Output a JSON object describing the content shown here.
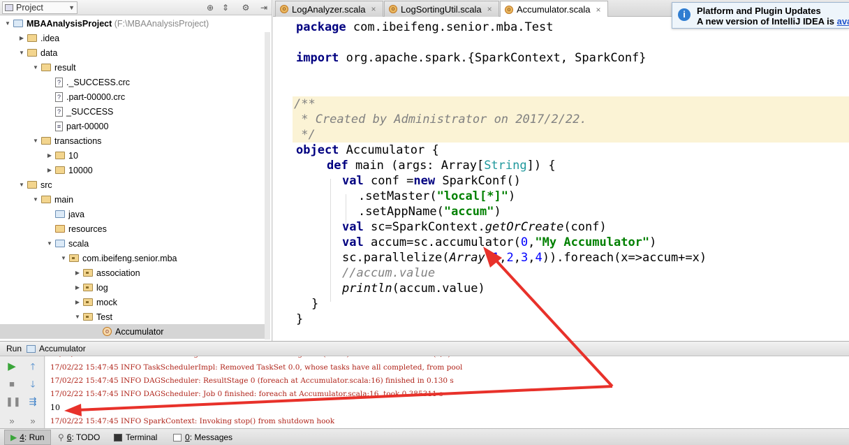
{
  "project_panel": {
    "selector_label": "Project",
    "tree": [
      {
        "label": "MBAAnalysisProject",
        "hint": "(F:\\MBAAnalysisProject)",
        "kind": "module",
        "expanded": true
      },
      {
        "label": ".idea",
        "kind": "folder",
        "expanded": false
      },
      {
        "label": "data",
        "kind": "folder",
        "expanded": true
      },
      {
        "label": "result",
        "kind": "folder",
        "expanded": true
      },
      {
        "label": "._SUCCESS.crc",
        "kind": "file"
      },
      {
        "label": ".part-00000.crc",
        "kind": "file"
      },
      {
        "label": "_SUCCESS",
        "kind": "file"
      },
      {
        "label": "part-00000",
        "kind": "file"
      },
      {
        "label": "transactions",
        "kind": "folder",
        "expanded": true
      },
      {
        "label": "10",
        "kind": "folder",
        "expanded": false
      },
      {
        "label": "10000",
        "kind": "folder",
        "expanded": false
      },
      {
        "label": "src",
        "kind": "folder",
        "expanded": true
      },
      {
        "label": "main",
        "kind": "folder",
        "expanded": true
      },
      {
        "label": "java",
        "kind": "source-folder"
      },
      {
        "label": "resources",
        "kind": "resource-folder"
      },
      {
        "label": "scala",
        "kind": "source-folder",
        "expanded": true
      },
      {
        "label": "com.ibeifeng.senior.mba",
        "kind": "package",
        "expanded": true
      },
      {
        "label": "association",
        "kind": "package",
        "expanded": false
      },
      {
        "label": "log",
        "kind": "package",
        "expanded": false
      },
      {
        "label": "mock",
        "kind": "package",
        "expanded": false
      },
      {
        "label": "Test",
        "kind": "package",
        "expanded": true
      },
      {
        "label": "Accumulator",
        "kind": "scala-object",
        "selected": true
      }
    ]
  },
  "editor_tabs": [
    {
      "label": "LogAnalyzer.scala",
      "active": false
    },
    {
      "label": "LogSortingUtil.scala",
      "active": false
    },
    {
      "label": "Accumulator.scala",
      "active": true
    }
  ],
  "notification": {
    "title": "Platform and Plugin Updates",
    "body": "A new version of IntelliJ IDEA is",
    "link": "ava"
  },
  "code": {
    "l1_kw": "package",
    "l1_rest": " com.ibeifeng.senior.mba.Test",
    "l2_kw": "import",
    "l2_rest": " org.apache.spark.{SparkContext, SparkConf}",
    "c1": "/**",
    "c2": " * Created by Administrator on 2017/2/22.",
    "c3": " */",
    "obj_kw": "object",
    "obj_name": " Accumulator {",
    "def_kw": "def",
    "def_a": " main (args: Array[",
    "def_type": "String",
    "def_b": "]) {",
    "val_kw": "val",
    "conf_a": " conf =",
    "new_kw": "new",
    "conf_b": " SparkConf()",
    "master_a": ".setMaster(",
    "master_str": "\"local[*]\"",
    "master_b": ")",
    "app_a": ".setAppName(",
    "app_str": "\"accum\"",
    "app_b": ")",
    "sc_a": " sc=SparkContext.",
    "sc_it": "getOrCreate",
    "sc_b": "(conf)",
    "acc_a": " accum=sc.accumulator(",
    "acc_n": "0",
    "acc_sep": ",",
    "acc_str": "\"My Accumulator\"",
    "acc_b": ")",
    "par_a": "sc.parallelize(",
    "par_it": "Array",
    "par_open": "(",
    "par_n1": "1",
    "par_n2": "2",
    "par_n3": "3",
    "par_n4": "4",
    "par_comma": ",",
    "par_b": ")).foreach(x=>accum+=x)",
    "cmt_line": "//accum.value",
    "pr_it": "println",
    "pr_b": "(accum.value)",
    "close_inner": "}",
    "close_outer": "}"
  },
  "run_panel": {
    "run_label": "Run",
    "config_name": "Accumulator",
    "console_lines": [
      "17/02/22 15:47:45 INFO TaskSchedulerImpl: Removed TaskSet 0.0, whose tasks have all completed, from pool",
      "17/02/22 15:47:45 INFO DAGScheduler: ResultStage 0 (foreach at Accumulator.scala:16) finished in 0.130 s",
      "17/02/22 15:47:45 INFO DAGScheduler: Job 0 finished: foreach at Accumulator.scala:16, took 0.385311 s",
      "10",
      "17/02/22 15:47:45 INFO SparkContext: Invoking stop() from shutdown hook"
    ]
  },
  "bottom_tabs": [
    {
      "num": "4",
      "label": ": Run",
      "active": true
    },
    {
      "num": "6",
      "label": ": TODO",
      "active": false
    },
    {
      "num": "",
      "label": "Terminal",
      "active": false
    },
    {
      "num": "0",
      "label": ": Messages",
      "active": false
    }
  ],
  "colors": {
    "keyword": "#000080",
    "string": "#008000",
    "number": "#0000ff",
    "comment": "#808080",
    "console_info": "#b0241a",
    "annotation_arrow": "#e8312a"
  }
}
